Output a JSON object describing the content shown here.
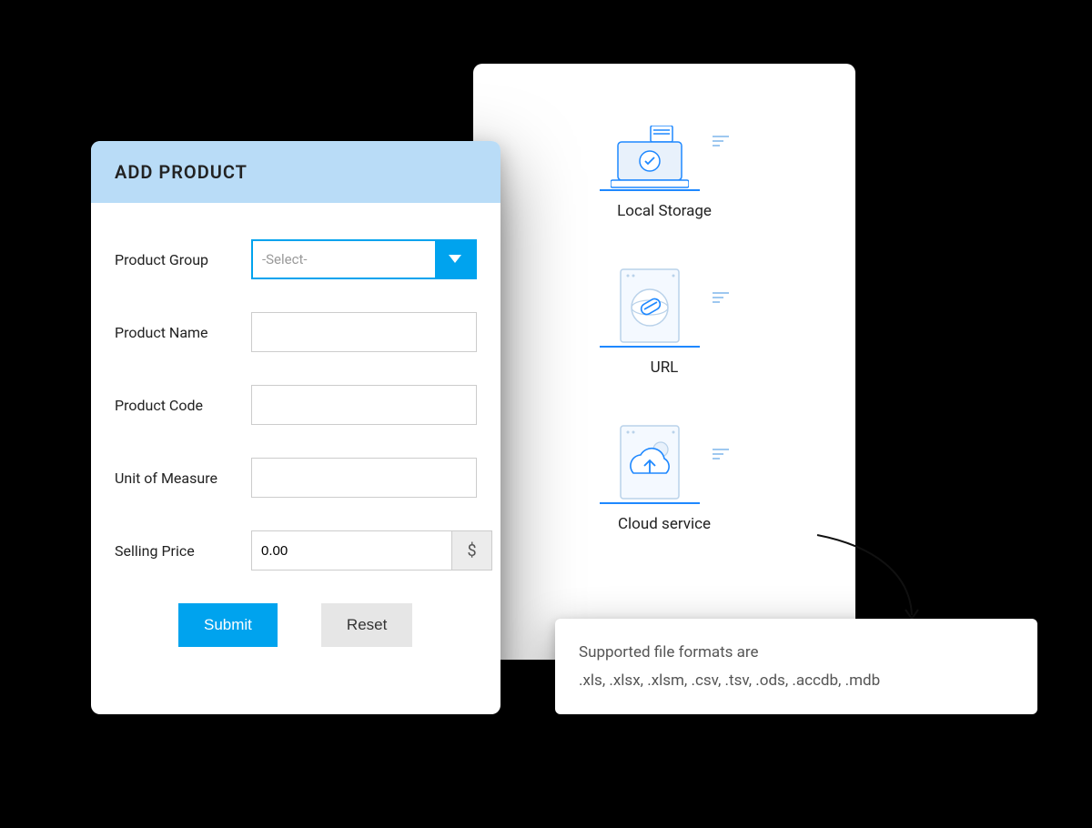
{
  "form": {
    "title": "ADD PRODUCT",
    "fields": {
      "product_group": {
        "label": "Product Group",
        "placeholder": "-Select-"
      },
      "product_name": {
        "label": "Product Name"
      },
      "product_code": {
        "label": "Product Code"
      },
      "unit": {
        "label": "Unit of Measure"
      },
      "price": {
        "label": "Selling Price",
        "value": "0.00",
        "currency": "$"
      }
    },
    "actions": {
      "submit": "Submit",
      "reset": "Reset"
    }
  },
  "sources": {
    "local": "Local Storage",
    "url": "URL",
    "cloud": "Cloud service"
  },
  "tooltip": {
    "line1": "Supported file formats are",
    "line2": ".xls, .xlsx, .xlsm, .csv, .tsv, .ods, .accdb, .mdb"
  }
}
